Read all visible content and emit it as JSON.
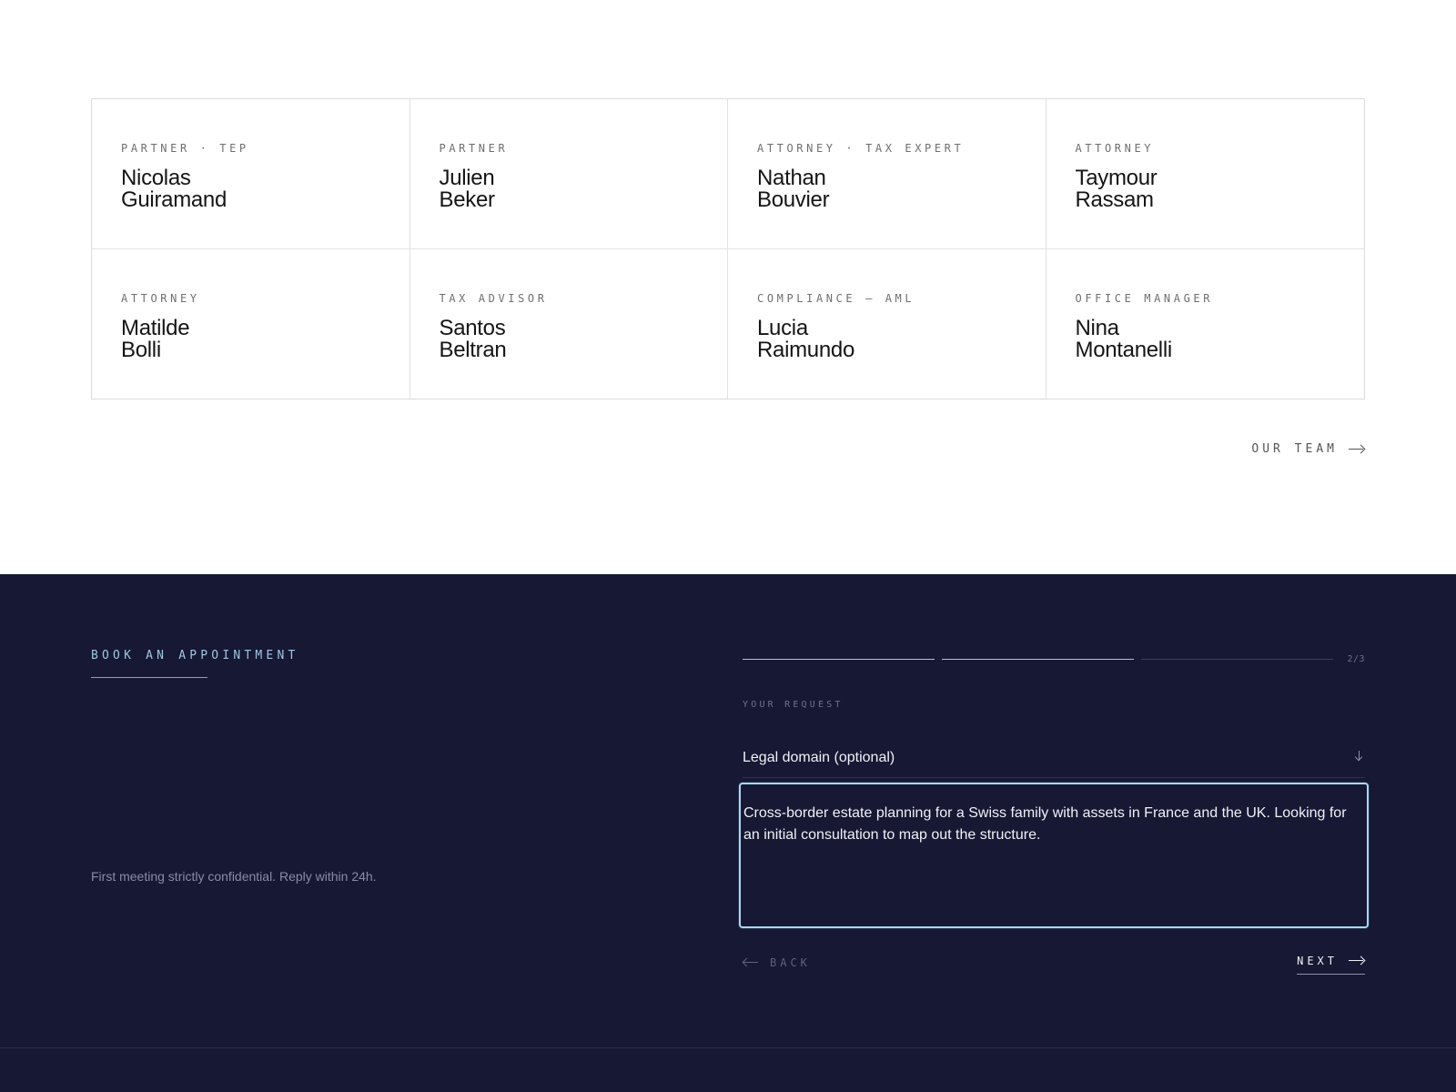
{
  "team": {
    "members": [
      {
        "role": "PARTNER · TEP",
        "first_name": "Nicolas",
        "last_name": "Guiramand"
      },
      {
        "role": "PARTNER",
        "first_name": "Julien",
        "last_name": "Beker"
      },
      {
        "role": "ATTORNEY · TAX EXPERT",
        "first_name": "Nathan",
        "last_name": "Bouvier"
      },
      {
        "role": "ATTORNEY",
        "first_name": "Taymour",
        "last_name": "Rassam"
      },
      {
        "role": "ATTORNEY",
        "first_name": "Matilde",
        "last_name": "Bolli"
      },
      {
        "role": "TAX ADVISOR",
        "first_name": "Santos",
        "last_name": "Beltran"
      },
      {
        "role": "COMPLIANCE — AML",
        "first_name": "Lucia",
        "last_name": "Raimundo"
      },
      {
        "role": "OFFICE MANAGER",
        "first_name": "Nina",
        "last_name": "Montanelli"
      }
    ],
    "link_label": "OUR TEAM"
  },
  "booking": {
    "heading": "BOOK AN APPOINTMENT",
    "confidential_note": "First meeting strictly confidential. Reply within 24h.",
    "progress": {
      "current_step": 2,
      "total_steps": 3,
      "label": "2/3"
    },
    "section_label": "YOUR REQUEST",
    "domain_select": {
      "value": "Legal domain (optional)"
    },
    "request_text": "Cross-border estate planning for a Swiss family with assets in France and the UK. Looking for an initial consultation to map out the structure.",
    "back_label": "BACK",
    "next_label": "NEXT"
  },
  "icons": {
    "team_link": "arrow-right-icon",
    "select": "arrow-down-icon",
    "back": "arrow-left-icon",
    "next": "arrow-right-icon"
  },
  "colors": {
    "dark_background": "#161834",
    "accent": "#9fc6e0",
    "focus_border": "#a8d8ee"
  }
}
